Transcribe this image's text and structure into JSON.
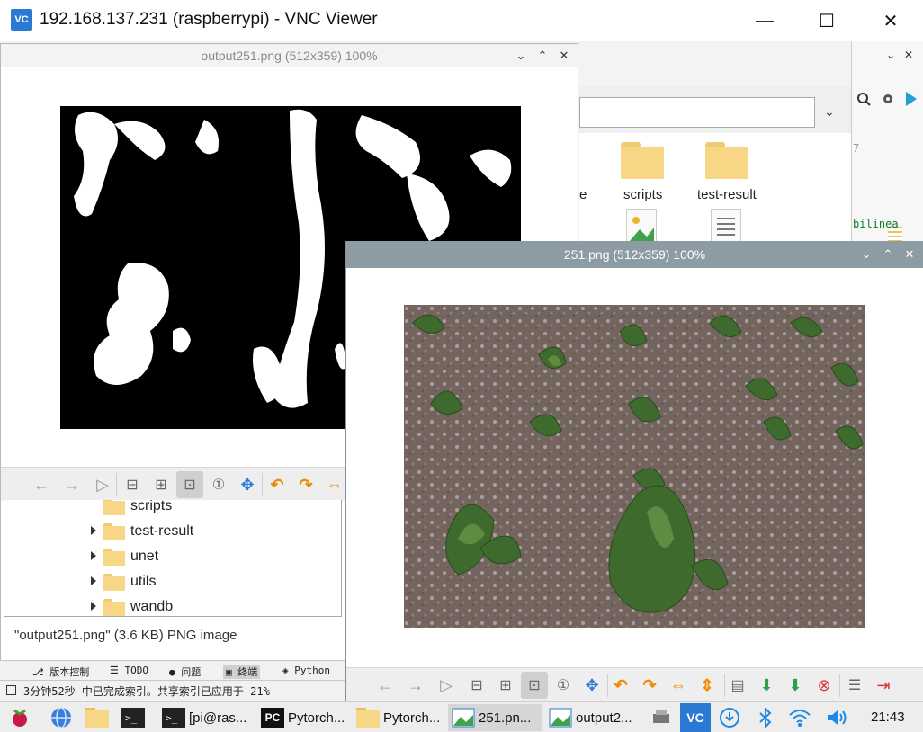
{
  "vnc": {
    "title": "192.168.137.231 (raspberrypi) - VNC Viewer",
    "logo": "VC",
    "controls": {
      "minimize": "—",
      "maximize": "☐",
      "close": "✕"
    }
  },
  "background_fm": {
    "partial_label": "e_",
    "folders": [
      "scripts",
      "test-result"
    ],
    "path_chevron": "⌄"
  },
  "ide": {
    "line_number": "7",
    "code_text": "bilinea",
    "controls": [
      "⌄",
      "✕"
    ]
  },
  "win1": {
    "title": "output251.png (512x359) 100%",
    "controls": [
      "⌄",
      "⌃",
      "✕"
    ],
    "status": "\"output251.png\" (3.6 KB) PNG image"
  },
  "win2": {
    "title": "251.png (512x359) 100%",
    "controls": [
      "⌄",
      "⌃",
      "✕"
    ]
  },
  "toolbar_icons": {
    "back": "←",
    "forward": "→",
    "play": "▷",
    "zoom_out": "⊟",
    "zoom_in": "⊞",
    "zoom_fit": "⊡",
    "zoom_orig": "①",
    "full": "✥",
    "rotate_left": "↶",
    "rotate_right": "↷",
    "flip_h": "⇔",
    "flip_v": "⇕",
    "open": "▤",
    "save": "⬇",
    "save_as": "⬇",
    "delete": "⊗",
    "prefs": "☰",
    "quit": "⇥"
  },
  "tree": {
    "items": [
      {
        "label": "scripts",
        "expandable": false
      },
      {
        "label": "test-result",
        "expandable": true
      },
      {
        "label": "unet",
        "expandable": true
      },
      {
        "label": "utils",
        "expandable": true
      },
      {
        "label": "wandb",
        "expandable": true
      }
    ]
  },
  "pycharm": {
    "tools": [
      "版本控制",
      "TODO",
      "问题",
      "终端",
      "Python"
    ],
    "status": "3分钟52秒 中已完成索引。共享索引已应用于 21%"
  },
  "taskbar": {
    "buttons": [
      {
        "label": "[pi@ras...",
        "icon": "terminal-icon"
      },
      {
        "label": "Pytorch...",
        "icon": "pycharm-icon"
      },
      {
        "label": "Pytorch...",
        "icon": "folder-icon"
      },
      {
        "label": "251.pn...",
        "icon": "image-icon"
      },
      {
        "label": "output2...",
        "icon": "image-icon"
      }
    ],
    "pycharm_badge": "PC",
    "vnc_badge": "VC",
    "clock": "21:43"
  },
  "colors": {
    "titlebar_active": "#8c9ba4",
    "folder": "#f7d686",
    "accent_blue": "#2a79d2"
  }
}
